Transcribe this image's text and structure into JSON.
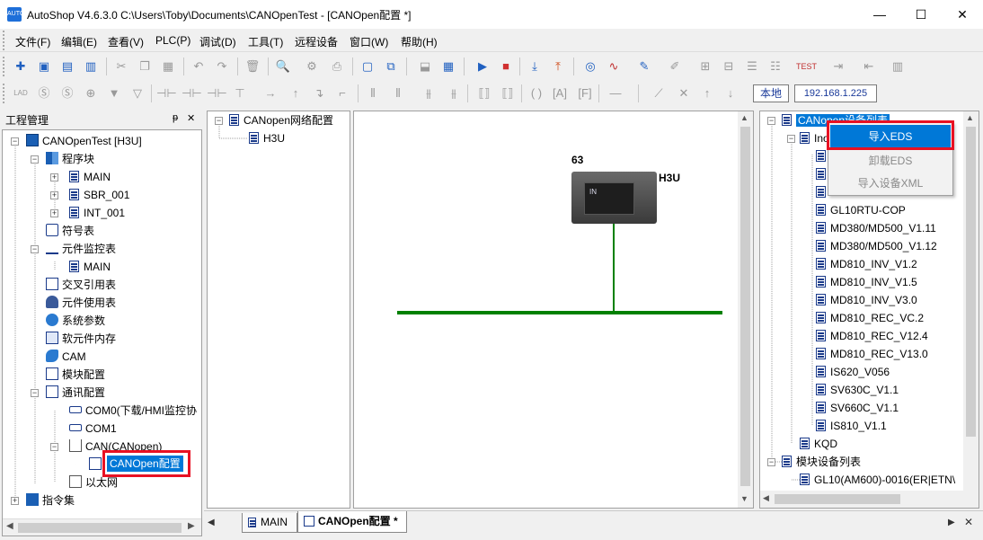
{
  "window": {
    "title": "AutoShop V4.6.3.0  C:\\Users\\Toby\\Documents\\CANOpenTest - [CANOpen配置 *]",
    "app_icon_text": "AUTO",
    "min_glyph": "—",
    "max_glyph": "☐",
    "close_glyph": "✕"
  },
  "menu": [
    "文件(F)",
    "编辑(E)",
    "查看(V)",
    "PLC(P)",
    "调试(D)",
    "工具(T)",
    "远程设备",
    "窗口(W)",
    "帮助(H)"
  ],
  "toolbar2": {
    "local_label": "本地",
    "ip_value": "192.168.1.225"
  },
  "project_panel": {
    "title": "工程管理",
    "pin_glyph": "ᵽ",
    "close_glyph": "✕",
    "root": "CANOpenTest [H3U]",
    "items": {
      "program_block": "程序块",
      "main": "MAIN",
      "sbr": "SBR_001",
      "int": "INT_001",
      "symbols": "符号表",
      "monitor": "元件监控表",
      "monitor_main": "MAIN",
      "xref": "交叉引用表",
      "usage": "元件使用表",
      "sysparam": "系统参数",
      "softmem": "软元件内存",
      "cam": "CAM",
      "module_cfg": "模块配置",
      "comm_cfg": "通讯配置",
      "com0": "COM0(下载/HMI监控协",
      "com1": "COM1",
      "can": "CAN(CANopen)",
      "canopen_cfg": "CANOpen配置",
      "ethernet": "以太网",
      "instructions": "指令集"
    }
  },
  "network_panel": {
    "root": "CANopen网络配置",
    "child": "H3U"
  },
  "canvas": {
    "node_id": "63",
    "node_label": "H3U",
    "device_text": "IN"
  },
  "device_panel": {
    "root": "CANopen设备列表",
    "sub": "Ino",
    "devices": [
      "GL10RTU-COP",
      "MD380/MD500_V1.11",
      "MD380/MD500_V1.12",
      "MD810_INV_V1.2",
      "MD810_INV_V1.5",
      "MD810_INV_V3.0",
      "MD810_REC_VC.2",
      "MD810_REC_V12.4",
      "MD810_REC_V13.0",
      "IS620_V056",
      "SV630C_V1.1",
      "SV660C_V1.1",
      "IS810_V1.1"
    ],
    "kqd": "KQD",
    "module_list": "模块设备列表",
    "module_item": "GL10(AM600)-0016(ER|ETN\\"
  },
  "context_menu": {
    "items": [
      "导入EDS",
      "卸载EDS",
      "导入设备XML"
    ]
  },
  "tabs": {
    "main": "MAIN",
    "canopen": "CANOpen配置 *"
  },
  "colors": {
    "selection": "#0078d7",
    "highlight_red": "#e81123",
    "bus_green": "#008000"
  }
}
